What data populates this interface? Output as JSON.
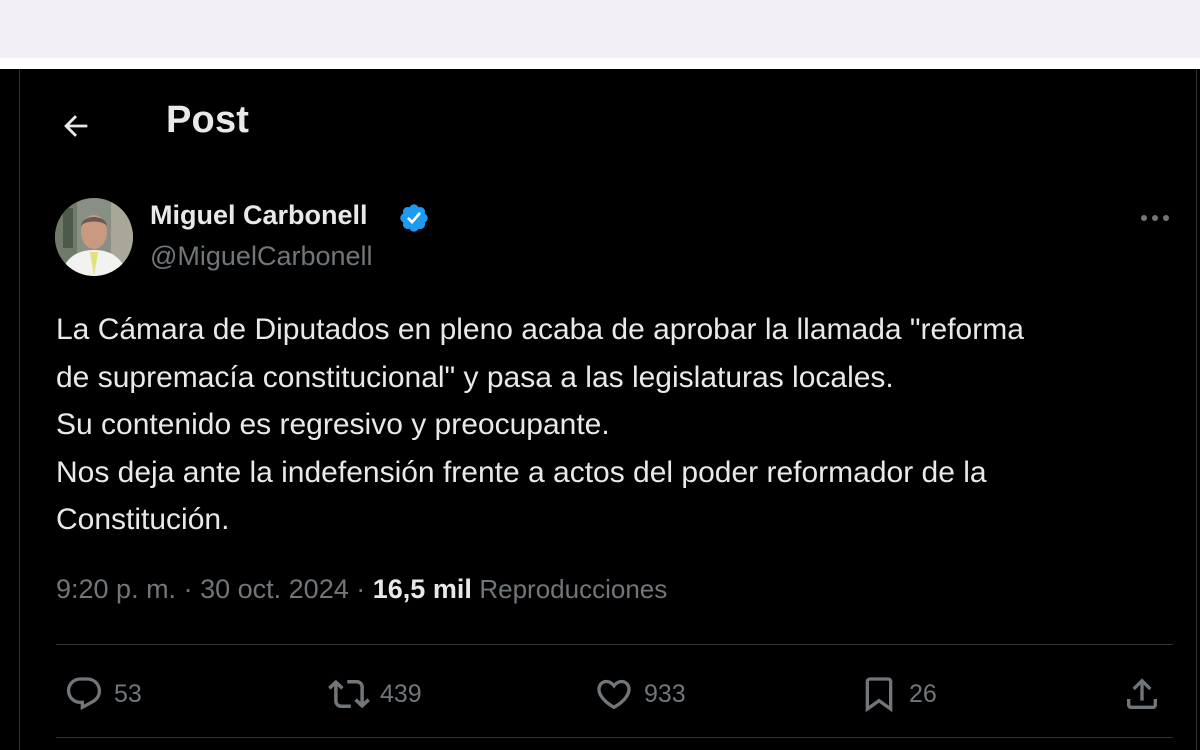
{
  "header": {
    "title": "Post"
  },
  "post": {
    "author_name": "Miguel Carbonell",
    "author_handle": "@MiguelCarbonell",
    "text_lines": [
      "La Cámara de Diputados en pleno acaba de aprobar la llamada \"reforma",
      "de supremacía constitucional\" y pasa a las legislaturas locales.",
      "Su contenido es regresivo y preocupante.",
      "Nos deja ante la indefensión frente a actos del poder reformador de la",
      "Constitución."
    ],
    "time": "9:20 p. m.",
    "separator": "·",
    "date": "30 oct. 2024",
    "views_count": "16,5 mil",
    "views_label": "Reproducciones"
  },
  "actions": {
    "replies": "53",
    "reposts": "439",
    "likes": "933",
    "bookmarks": "26"
  },
  "icons": {
    "back": "arrow-left-icon",
    "verified": "verified-badge-icon",
    "more": "more-horizontal-icon",
    "reply": "reply-icon",
    "repost": "repost-icon",
    "like": "heart-icon",
    "bookmark": "bookmark-icon",
    "share": "share-icon"
  },
  "colors": {
    "background": "#000000",
    "text_primary": "#e7e9ea",
    "text_secondary": "#71767b",
    "verified_blue": "#1d9bf0",
    "divider": "#2f3336"
  }
}
